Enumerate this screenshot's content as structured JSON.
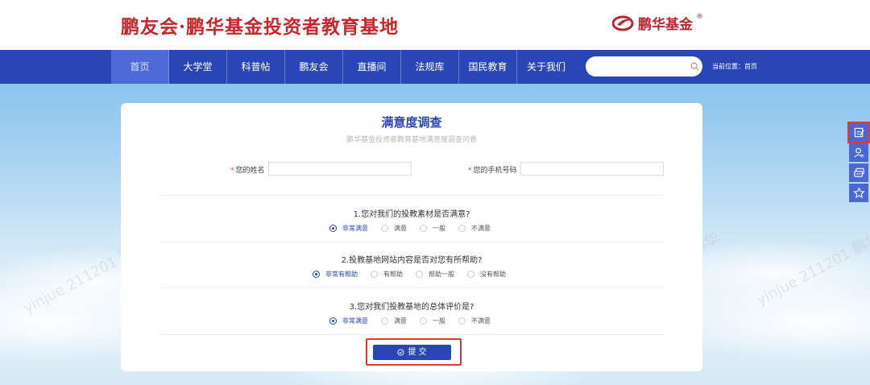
{
  "header": {
    "site_title": "鹏友会·鹏华基金投资者教育基地",
    "brand_name": "鹏华基金",
    "brand_reg": "®"
  },
  "nav": {
    "items": [
      {
        "label": "首页",
        "active": true
      },
      {
        "label": "大学堂"
      },
      {
        "label": "科普帖"
      },
      {
        "label": "鹏友会"
      },
      {
        "label": "直播间"
      },
      {
        "label": "法规库"
      },
      {
        "label": "国民教育"
      },
      {
        "label": "关于我们"
      }
    ],
    "search_placeholder": "",
    "location": "当前位置：首页"
  },
  "survey": {
    "title": "满意度调查",
    "subtitle": "鹏华基金投资者教育基地满意度调查问卷",
    "name_required": "*",
    "name_label": "您的姓名",
    "phone_required": "*",
    "phone_label": "您的手机号码",
    "questions": [
      {
        "text": "1.您对我们的投教素材是否满意?",
        "options": [
          "非常满意",
          "满意",
          "一般",
          "不满意"
        ],
        "selected": "非常满意"
      },
      {
        "text": "2.投教基地网站内容是否对您有所帮助?",
        "options": [
          "非常有帮助",
          "有帮助",
          "帮助一般",
          "没有帮助"
        ],
        "selected": "非常有帮助"
      },
      {
        "text": "3.您对我们投教基地的总体评价是?",
        "options": [
          "非常满意",
          "满意",
          "一般",
          "不满意"
        ],
        "selected": "非常满意"
      }
    ],
    "submit_label": "提 交"
  },
  "side_tools": [
    "survey-edit-icon",
    "user-icon",
    "chat-icon",
    "star-icon"
  ],
  "watermark_text": "yinjue 211201 鹏华",
  "colors": {
    "primary": "#2a46b6",
    "brand_red": "#c6272b",
    "highlight": "#e03a2f"
  }
}
